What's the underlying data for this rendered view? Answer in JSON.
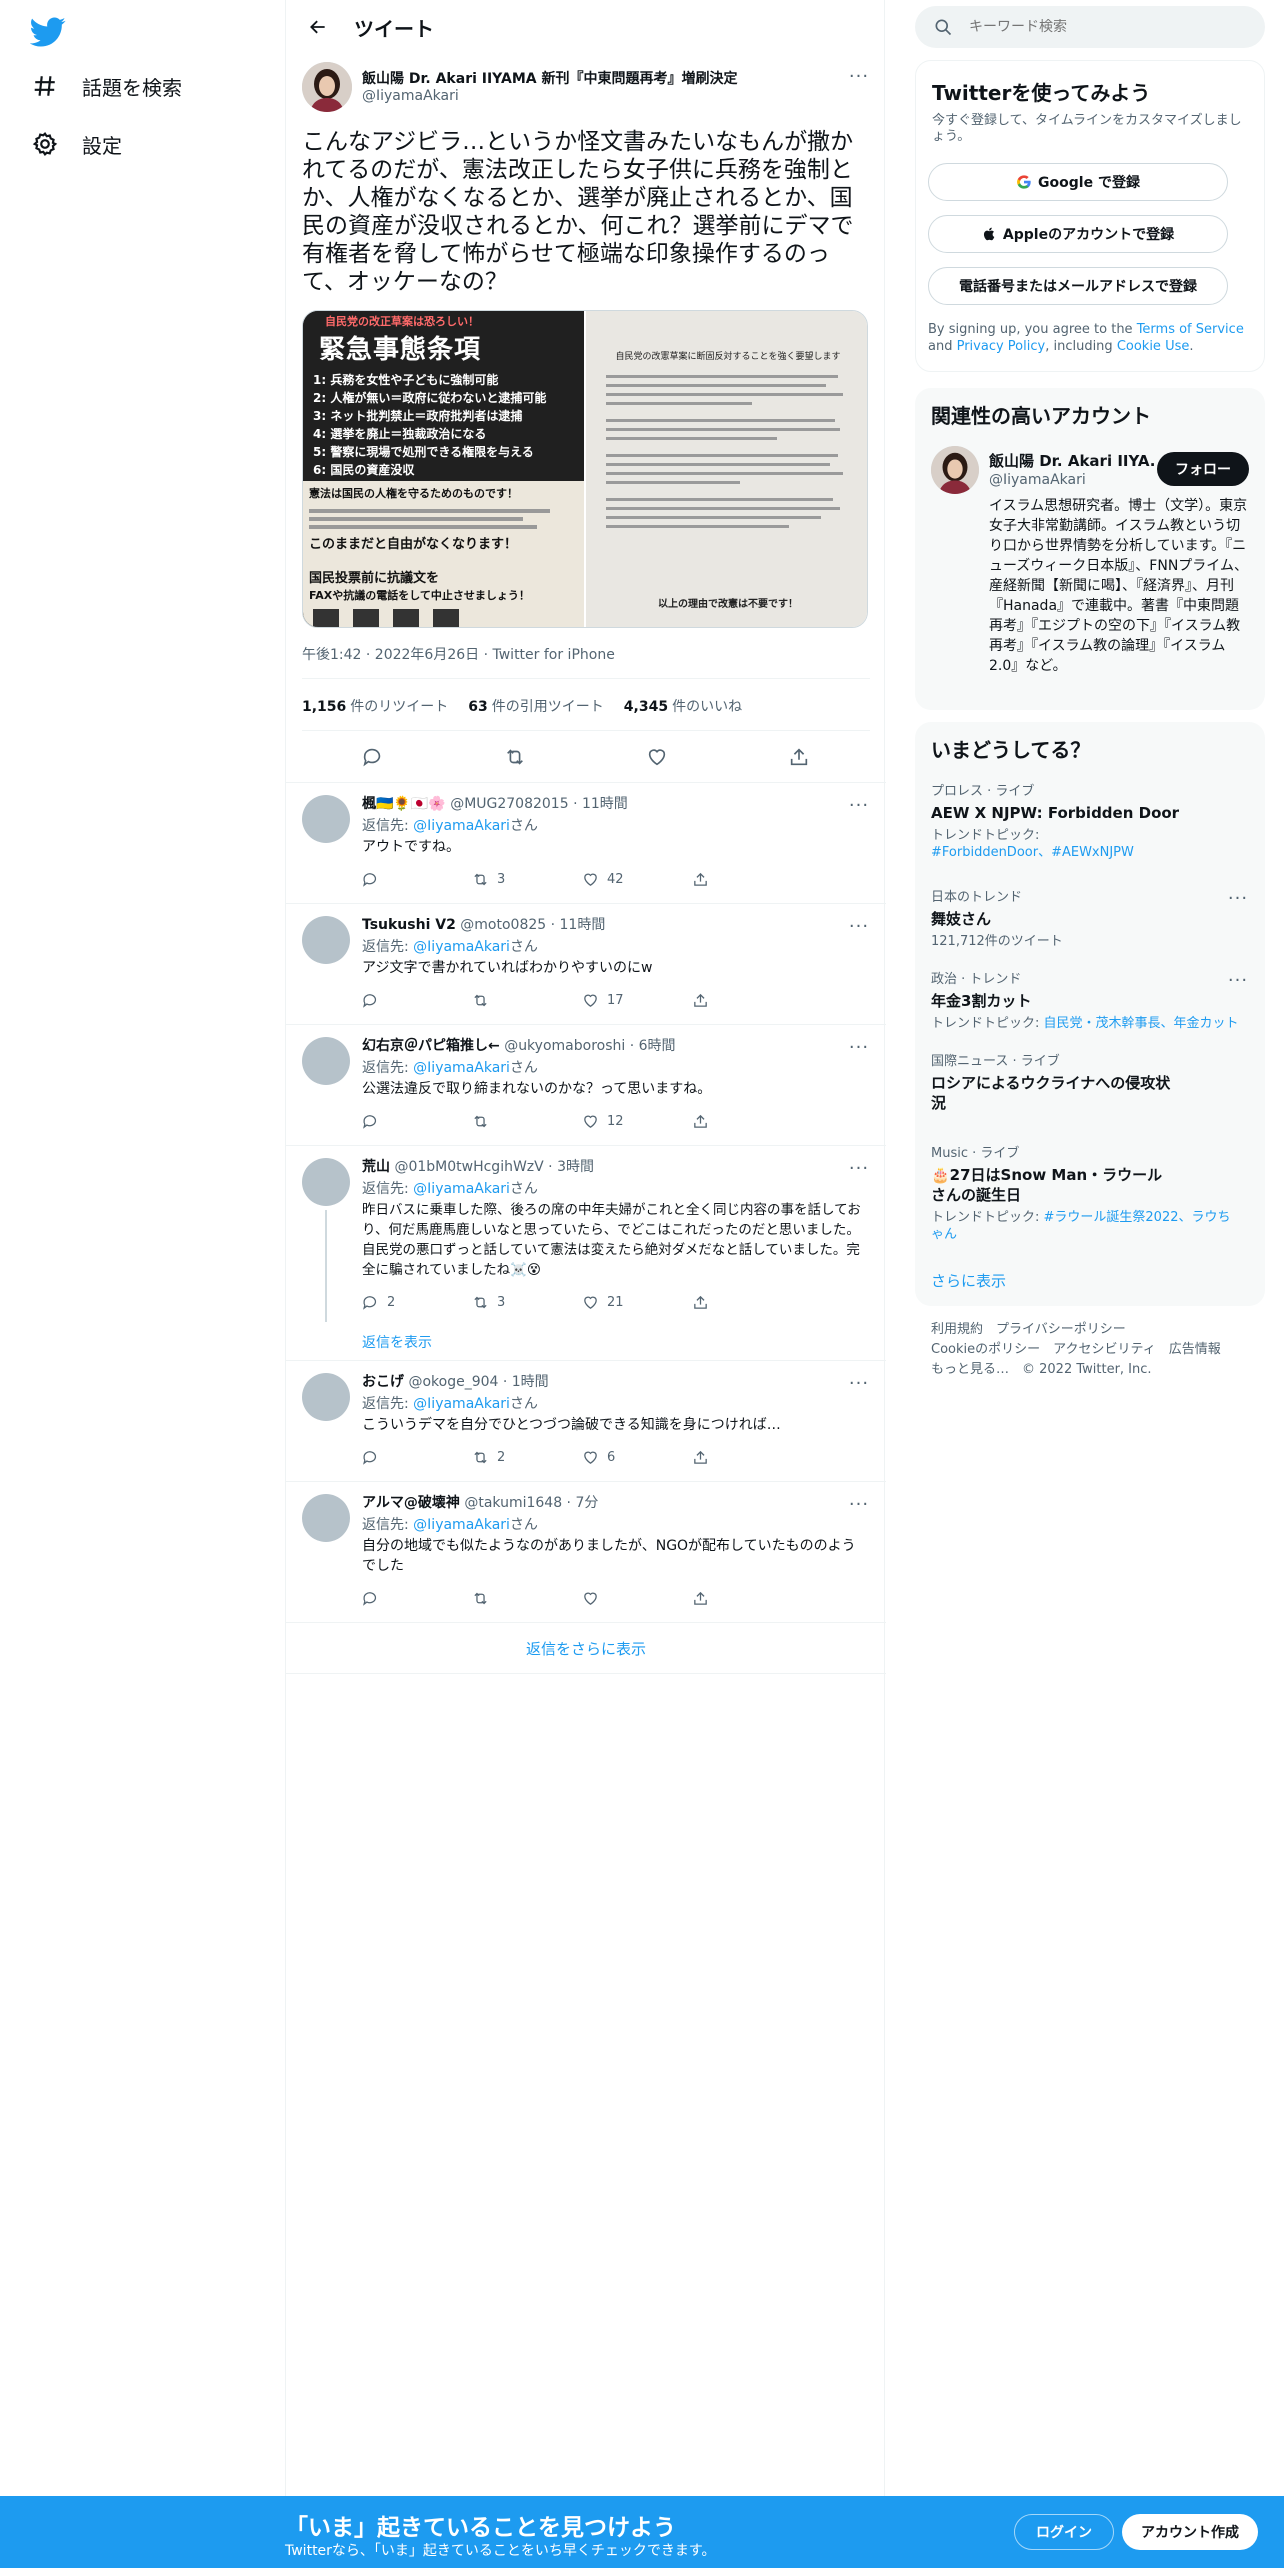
{
  "nav": {
    "explore": "話題を検索",
    "settings": "設定"
  },
  "header": {
    "title": "ツイート"
  },
  "tweet": {
    "name": "飯山陽 Dr. Akari IIYAMA 新刊『中東問題再考』増刷決定",
    "handle": "@IiyamaAkari",
    "text": "こんなアジビラ…というか怪文書みたいなもんが撒かれてるのだが、憲法改正したら女子供に兵務を強制とか、人権がなくなるとか、選挙が廃止されるとか、国民の資産が没収されるとか、何これ？選挙前にデマで有権者を脅して怖がらせて極端な印象操作するのって、オッケーなの？",
    "time": "午後1:42 · 2022年6月26日 · Twitter for iPhone",
    "retweets": "1,156",
    "retweets_label": "件のリツイート",
    "quotes": "63",
    "quotes_label": "件の引用ツイート",
    "likes": "4,345",
    "likes_label": "件のいいね",
    "flyer_left": {
      "heading": "自民党の改正草案は恐ろしい！",
      "title": "緊急事態条項",
      "items": [
        "1: 兵務を女性や子どもに強制可能",
        "2: 人権が無い＝政府に従わないと逮捕可能",
        "3: ネット批判禁止＝政府批判者は逮捕",
        "4: 選挙を廃止＝独裁政治になる",
        "5: 警察に現場で処刑できる権限を与える",
        "6: 国民の資産没収"
      ],
      "bottom1": "憲法は国民の人権を守るためのものです！",
      "bottom2": "このままだと自由がなくなります！",
      "bottom3": "国民投票前に抗議文を",
      "bottom4": "FAXや抗議の電話をして中止させましょう！"
    },
    "flyer_right": {
      "title": "自民党の改憲草案に断固反対することを強く要望します",
      "footer": "以上の理由で改憲は不要です！"
    }
  },
  "replies": [
    {
      "name": "楓🇺🇦🌻🇯🇵🌸",
      "handle": "@MUG27082015 · 11時間",
      "to_label": "返信先: ",
      "to": "@IiyamaAkari",
      "to_suffix": "さん",
      "text": "アウトですね。",
      "replies": "",
      "retweets": "3",
      "likes": "42"
    },
    {
      "name": "Tsukushi V2",
      "handle": "@moto0825 · 11時間",
      "to_label": "返信先: ",
      "to": "@IiyamaAkari",
      "to_suffix": "さん",
      "text": "アジ文字で書かれていればわかりやすいのにw",
      "replies": "",
      "retweets": "",
      "likes": "17"
    },
    {
      "name": "幻右京＠パピ箱推し←",
      "handle": "@ukyomaboroshi · 6時間",
      "to_label": "返信先: ",
      "to": "@IiyamaAkari",
      "to_suffix": "さん",
      "text": "公選法違反で取り締まれないのかな？って思いますね。",
      "replies": "",
      "retweets": "",
      "likes": "12"
    },
    {
      "name": "荒山",
      "handle": "@01bM0twHcgihWzV · 3時間",
      "to_label": "返信先: ",
      "to": "@IiyamaAkari",
      "to_suffix": "さん",
      "text": "昨日バスに乗車した際、後ろの席の中年夫婦がこれと全く同じ内容の事を話しており、何だ馬鹿馬鹿しいなと思っていたら、でどこはこれだったのだと思いました。自民党の悪口ずっと話していて憲法は変えたら絶対ダメだなと話していました。完全に騙されていましたね☠️😵",
      "replies": "2",
      "retweets": "3",
      "likes": "21",
      "show_replies": "返信を表示"
    },
    {
      "name": "おこげ",
      "handle": "@okoge_904 · 1時間",
      "to_label": "返信先: ",
      "to": "@IiyamaAkari",
      "to_suffix": "さん",
      "text": "こういうデマを自分でひとつづつ論破できる知識を身につければ…",
      "replies": "",
      "retweets": "2",
      "likes": "6"
    },
    {
      "name": "アルマ@破壊神",
      "handle": "@takumi1648 · 7分",
      "to_label": "返信先: ",
      "to": "@IiyamaAkari",
      "to_suffix": "さん",
      "text": "自分の地域でも似たようなのがありましたが、NGOが配布していたもののようでした",
      "replies": "",
      "retweets": "",
      "likes": ""
    }
  ],
  "more_replies": "返信をさらに表示",
  "search": {
    "placeholder": "キーワード検索"
  },
  "signup": {
    "title": "Twitterを使ってみよう",
    "sub": "今すぐ登録して、タイムラインをカスタマイズしましょう。",
    "google": "Google で登録",
    "apple": "Appleのアカウントで登録",
    "phone": "電話番号またはメールアドレスで登録",
    "terms_pre": "By signing up, you agree to the ",
    "terms_link": "Terms of Service",
    "terms_mid": " and ",
    "privacy_link": "Privacy Policy",
    "terms_mid2": ", including ",
    "cookie_link": "Cookie Use",
    "terms_end": "."
  },
  "related": {
    "title": "関連性の高いアカウント",
    "name": "飯山陽 Dr. Akari IIYA...",
    "handle": "@IiyamaAkari",
    "follow": "フォロー",
    "bio": "イスラム思想研究者。博士（文学）。東京女子大非常勤講師。イスラム教という切り口から世界情勢を分析しています。『ニューズウィーク日本版』、FNNプライム、産経新聞【新聞に喝】、『経済界』、月刊『Hanada』で連載中。著書『中東問題再考』『エジプトの空の下』『イスラム教再考』『イスラム教の論理』『イスラム2.0』など。"
  },
  "trends": {
    "title": "いまどうしてる？",
    "items": [
      {
        "category": "プロレス · ライブ",
        "name": "AEW X NJPW: Forbidden Door",
        "sub_label": "トレンドトピック: ",
        "sub_link": "#ForbiddenDoor、#AEWxNJPW"
      },
      {
        "category": "日本のトレンド",
        "name": "舞妓さん",
        "sub_label": "121,712件のツイート",
        "sub_link": ""
      },
      {
        "category": "政治 · トレンド",
        "name": "年金3割カット",
        "sub_label": "トレンドトピック: ",
        "sub_link": "自民党・茂木幹事長、年金カット"
      },
      {
        "category": "国際ニュース · ライブ",
        "name": "ロシアによるウクライナへの侵攻状況",
        "sub_label": "",
        "sub_link": ""
      },
      {
        "category": "Music · ライブ",
        "name": "🎂27日はSnow Man・ラウールさんの誕生日",
        "sub_label": "トレンドトピック: ",
        "sub_link": "#ラウール誕生祭2022、ラウちゃん"
      }
    ],
    "more": "さらに表示"
  },
  "footer": {
    "line1": "利用規約　プライバシーポリシー",
    "line2": "Cookieのポリシー　アクセシビリティ　広告情報",
    "line3": "もっと見る…　© 2022 Twitter, Inc."
  },
  "bottom": {
    "title": "「いま」起きていることを見つけよう",
    "sub": "Twitterなら、「いま」起きていることをいち早くチェックできます。",
    "login": "ログイン",
    "signup": "アカウント作成"
  },
  "colors": {
    "accent": "#1d9bf0",
    "text": "#0f1419",
    "muted": "#536471"
  }
}
